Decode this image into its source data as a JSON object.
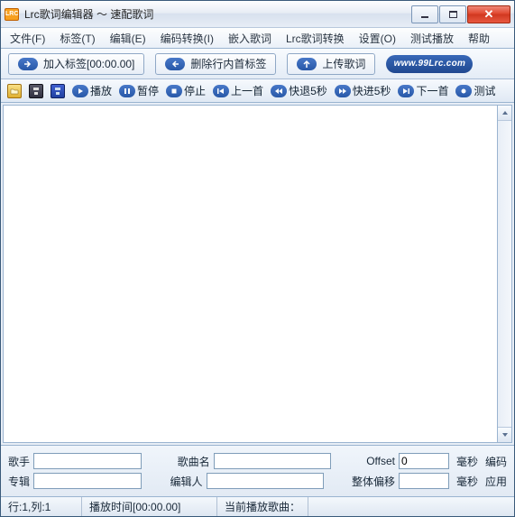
{
  "titlebar": {
    "icon_text": "LRC",
    "title": "Lrc歌词编辑器 ～ 速配歌词"
  },
  "menu": {
    "file": "文件(F)",
    "tag": "标签(T)",
    "edit": "编辑(E)",
    "encoding": "编码转换(I)",
    "embed": "嵌入歌词",
    "convert": "Lrc歌词转换",
    "settings": "设置(O)",
    "test": "测试播放",
    "help": "帮助"
  },
  "toolbar1": {
    "add_tag": "加入标签[00:00.00]",
    "delete_first": "删除行内首标签",
    "upload": "上传歌词",
    "logo": "www.99Lrc.com"
  },
  "toolbar2": {
    "play": "播放",
    "pause": "暂停",
    "stop": "停止",
    "prev": "上一首",
    "back5": "快退5秒",
    "fwd5": "快进5秒",
    "next": "下一首",
    "test": "测试"
  },
  "fields": {
    "singer_label": "歌手",
    "singer_value": "",
    "song_label": "歌曲名",
    "song_value": "",
    "offset_label": "Offset",
    "offset_value": "0",
    "ms_label": "毫秒",
    "encoding_label": "编码",
    "album_label": "专辑",
    "album_value": "",
    "author_label": "编辑人",
    "author_value": "",
    "shift_label": "整体偏移",
    "shift_value": "",
    "apply_label": "应用"
  },
  "status": {
    "pos": "行:1,列:1",
    "playtime": "播放时间[00:00.00]",
    "current": "当前播放歌曲："
  }
}
